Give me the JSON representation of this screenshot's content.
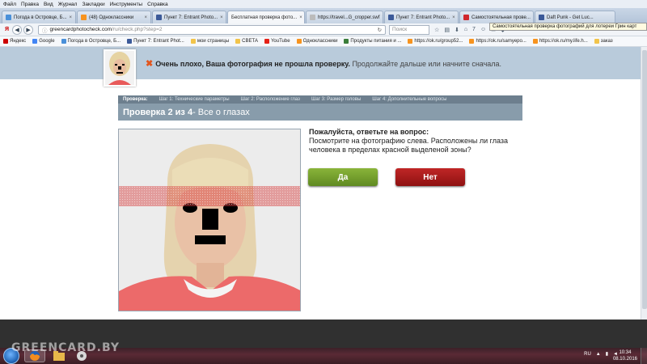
{
  "menu": [
    "Файл",
    "Правка",
    "Вид",
    "Журнал",
    "Закладки",
    "Инструменты",
    "Справка"
  ],
  "tabs": [
    {
      "label": "Погода в Островце, Б...",
      "color": "#4a90d9",
      "active": false
    },
    {
      "label": "(48) Одноклассники",
      "color": "#f7931e",
      "active": false
    },
    {
      "label": "Пункт 7: Entrant Photo...",
      "color": "#3c5a99",
      "active": false
    },
    {
      "label": "Бесплатная проверка фото...",
      "color": "#ffffff",
      "active": true
    },
    {
      "label": "https://travel...G_cropper.swf",
      "color": "#bbbbbb",
      "active": false
    },
    {
      "label": "Пункт 7: Entrant Photo...",
      "color": "#3c5a99",
      "active": false
    },
    {
      "label": "Самостоятельная прове...",
      "color": "#d0272c",
      "active": false
    },
    {
      "label": "Daft Punk - Get Luc...",
      "color": "#3b5998",
      "active": false
    }
  ],
  "tab_tooltip": "Самостоятельная проверка фотографий для лотереи Грин карт",
  "navbar": {
    "logo": "Я",
    "url_host": "greencardphotocheck.com",
    "url_path": "/ru/check.php?step=2",
    "search_placeholder": "Поиск",
    "counter": "7"
  },
  "bookmarks": [
    {
      "label": "Яндекс",
      "color": "#cc0000"
    },
    {
      "label": "Google",
      "color": "#4285f4"
    },
    {
      "label": "Погода в Островце, Б...",
      "color": "#4a90d9"
    },
    {
      "label": "Пункт 7: Entrant Phot...",
      "color": "#3c5a99"
    },
    {
      "label": "мои страницы",
      "color": "#f2c44a"
    },
    {
      "label": "СВЕТА",
      "color": "#f2c44a"
    },
    {
      "label": "YouTube",
      "color": "#e62117"
    },
    {
      "label": "Одноклассники",
      "color": "#f7931e"
    },
    {
      "label": "Продукты питания и ...",
      "color": "#3a7d3a"
    },
    {
      "label": "https://ok.ru/group52...",
      "color": "#f7931e"
    },
    {
      "label": "https://ok.ru/samyepo...",
      "color": "#f7931e"
    },
    {
      "label": "https://ok.ru/my.life.h...",
      "color": "#f7931e"
    },
    {
      "label": "заказ",
      "color": "#f2c44a"
    }
  ],
  "banner": {
    "bold": "Очень плохо, Ваша фотография не прошла проверку.",
    "rest": "Продолжайте дальше или начните сначала."
  },
  "steps": {
    "label": "Проверка:",
    "items": [
      "Шаг 1: Технические параметры",
      "Шаг 2: Расположение глаз",
      "Шаг 3: Размер головы",
      "Шаг 4: Дополнительные вопросы"
    ]
  },
  "step_title": {
    "bold": "Проверка 2 из 4",
    "rest": " - Все о глазах"
  },
  "question": {
    "head": "Пожалуйста, ответьте на вопрос:",
    "body": "Посмотрите на фотографию слева. Расположены ли глаза человека в пределах красной выделеной зоны?"
  },
  "buttons": {
    "yes": "Да",
    "no": "Нет"
  },
  "taskbar": {
    "watermark": "GREENCARD.BY",
    "lang": "RU",
    "time": "10:34",
    "date": "08.10.2016"
  }
}
